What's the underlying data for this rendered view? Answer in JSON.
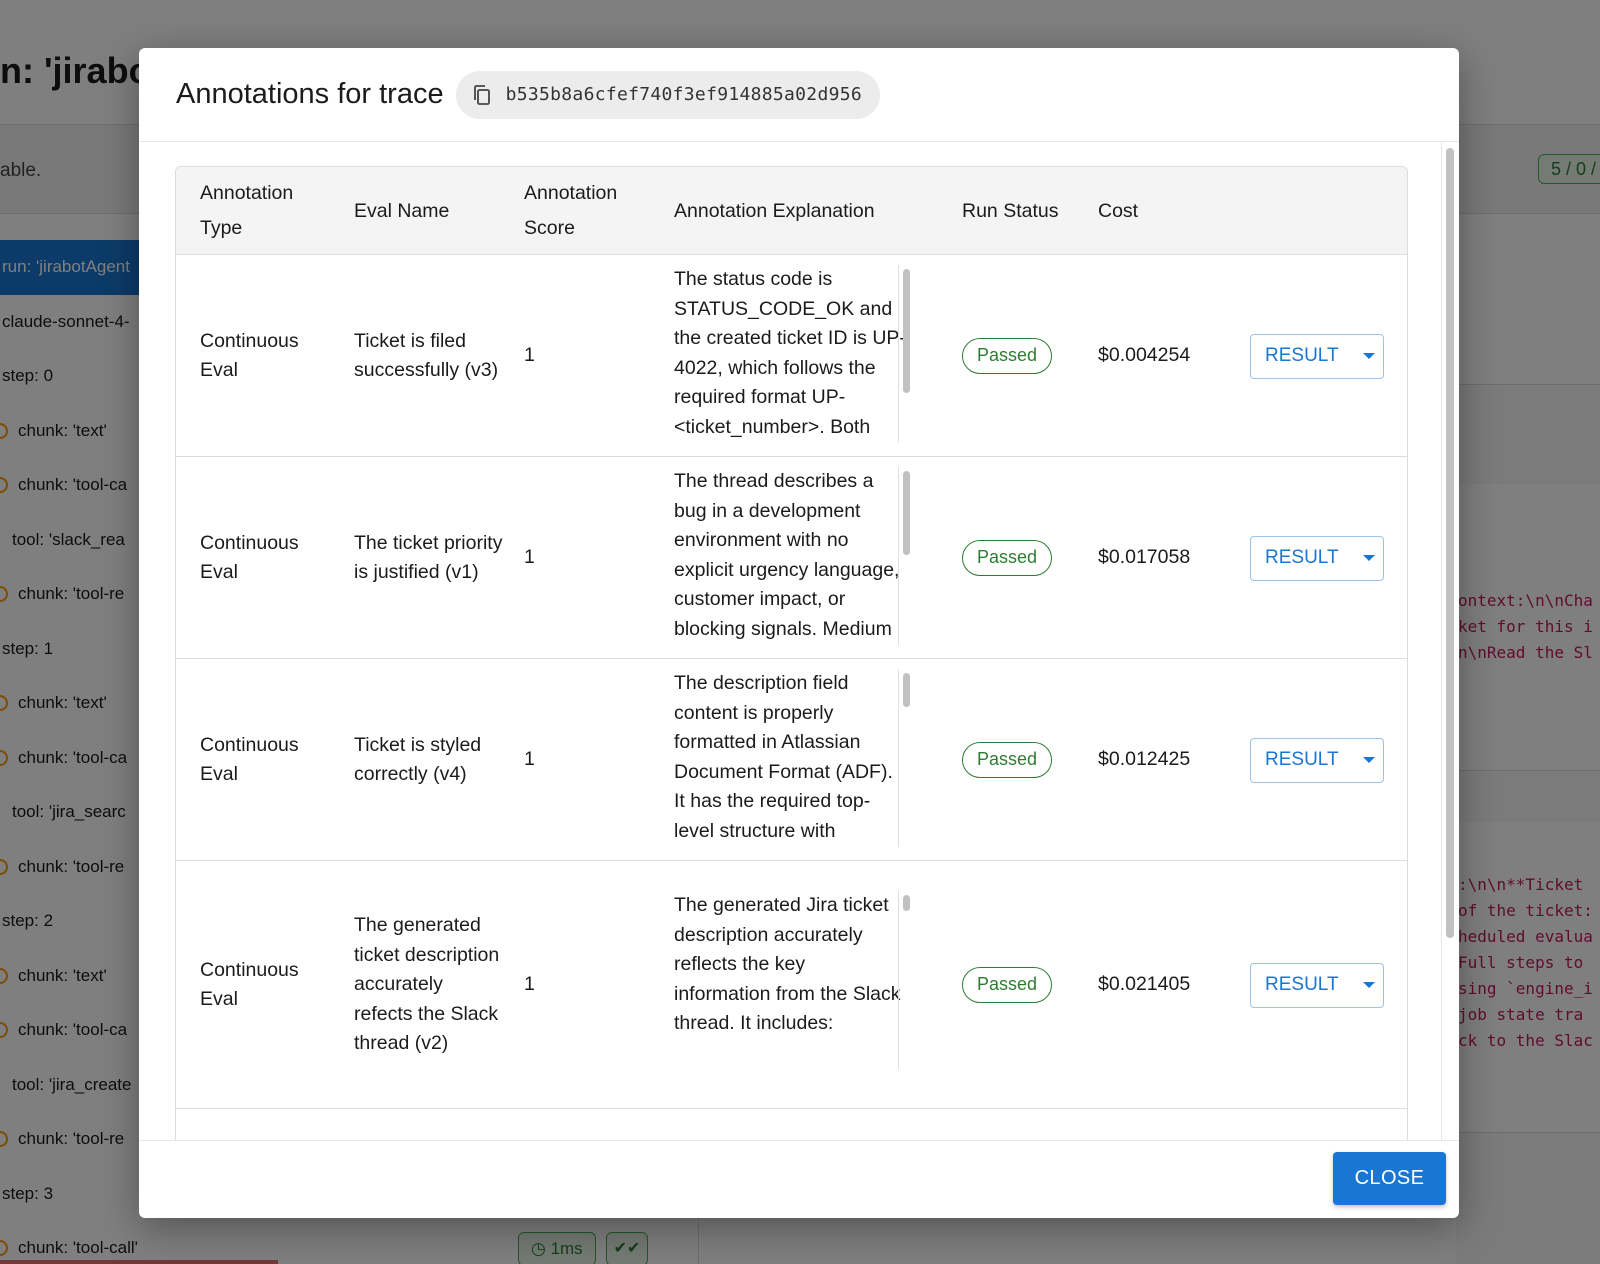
{
  "background": {
    "title": "n: 'jirabot",
    "subtext": "able.",
    "count_badge": "5 / 0 /",
    "tree": [
      {
        "label": "run: 'jirabotAgent",
        "level": "selected"
      },
      {
        "label": "claude-sonnet-4-",
        "level": "root"
      },
      {
        "label": "step: 0",
        "level": "root"
      },
      {
        "label": "chunk: 'text'",
        "level": "chunk"
      },
      {
        "label": "chunk: 'tool-ca",
        "level": "chunk"
      },
      {
        "label": "tool: 'slack_rea",
        "level": "tool"
      },
      {
        "label": "chunk: 'tool-re",
        "level": "chunk"
      },
      {
        "label": "step: 1",
        "level": "root"
      },
      {
        "label": "chunk: 'text'",
        "level": "chunk"
      },
      {
        "label": "chunk: 'tool-ca",
        "level": "chunk"
      },
      {
        "label": "tool: 'jira_searc",
        "level": "tool"
      },
      {
        "label": "chunk: 'tool-re",
        "level": "chunk"
      },
      {
        "label": "step: 2",
        "level": "root"
      },
      {
        "label": "chunk: 'text'",
        "level": "chunk"
      },
      {
        "label": "chunk: 'tool-ca",
        "level": "chunk"
      },
      {
        "label": "tool: 'jira_create",
        "level": "tool"
      },
      {
        "label": "chunk: 'tool-re",
        "level": "chunk"
      },
      {
        "label": "step: 3",
        "level": "root"
      },
      {
        "label": "chunk: 'tool-call'",
        "level": "chunk"
      }
    ],
    "code_block_1": [
      "ontext:\\n\\nCha",
      "ket for this i",
      "n\\nRead the Sl"
    ],
    "code_block_2": [
      ":\\n\\n**Ticket",
      "of the ticket:",
      "heduled evalua",
      "Full steps to",
      "sing `engine_i",
      " job state tra",
      "ck to the Slac"
    ],
    "time_chip": "1ms",
    "colors": {
      "selected": "#1976d2",
      "code": "#c2185b",
      "success": "#2e7d32"
    }
  },
  "dialog": {
    "title": "Annotations for trace",
    "trace_id": "b535b8a6cfef740f3ef914885a02d956",
    "columns": {
      "type": "Annotation Type",
      "name": "Eval Name",
      "score": "Annotation Score",
      "explanation": "Annotation Explanation",
      "status": "Run Status",
      "cost": "Cost"
    },
    "rows": [
      {
        "type": "Continuous Eval",
        "name": "Ticket is filed successfully (v3)",
        "score": "1",
        "explanation": "The status code is STATUS_CODE_OK and the created ticket ID is UP-4022, which follows the required format UP-<ticket_number>. Both",
        "status": "Passed",
        "cost": "$0.004254",
        "action": "RESULT"
      },
      {
        "type": "Continuous Eval",
        "name": "The ticket priority is justified (v1)",
        "score": "1",
        "explanation": "The thread describes a bug in a development environment with no explicit urgency language, customer impact, or blocking signals. Medium is the",
        "status": "Passed",
        "cost": "$0.017058",
        "action": "RESULT"
      },
      {
        "type": "Continuous Eval",
        "name": "Ticket is styled correctly (v4)",
        "score": "1",
        "explanation": "The description field content is properly formatted in Atlassian Document Format (ADF). It has the required top-level structure with",
        "status": "Passed",
        "cost": "$0.012425",
        "action": "RESULT"
      },
      {
        "type": "Continuous Eval",
        "name": "The generated ticket description accurately refects the Slack thread (v2)",
        "score": "1",
        "explanation": "The generated Jira ticket description accurately reflects the key information from the Slack thread. It includes:",
        "status": "Passed",
        "cost": "$0.021405",
        "action": "RESULT"
      }
    ],
    "close_label": "CLOSE",
    "colors": {
      "primary": "#1976d2",
      "passed": "#2e7d32",
      "header_bg": "#f4f4f4"
    }
  }
}
